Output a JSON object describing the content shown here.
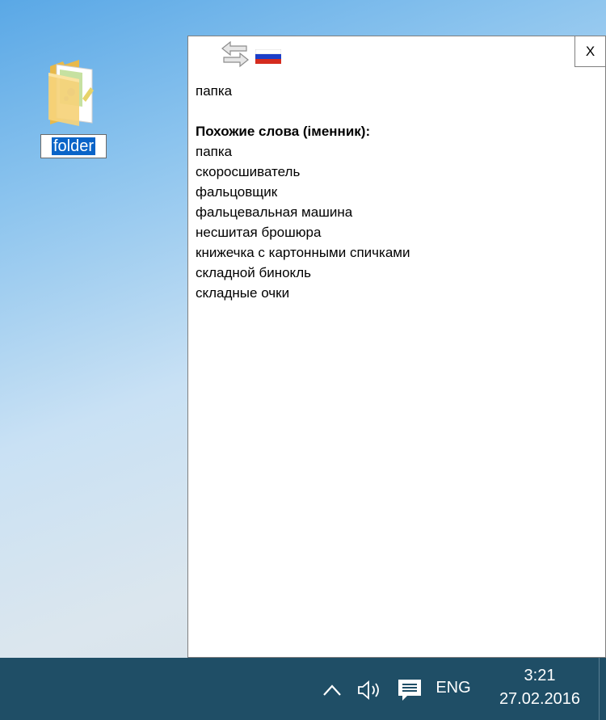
{
  "desktop": {
    "icon_label": "folder",
    "icon": "folder-icon"
  },
  "popup": {
    "close_label": "X",
    "swap_icon": "swap-arrows-icon",
    "flag_icon": "russian-flag-icon",
    "headword": "папка",
    "section_title": "Похожие слова (іменник):",
    "words": [
      "папка",
      "скоросшиватель",
      "фальцовщик",
      "фальцевальная машина",
      "несшитая брошюра",
      "книжечка с картонными спичками",
      "складной бинокль",
      "складные очки"
    ]
  },
  "taskbar": {
    "color": "#1f4e66",
    "language": "ENG",
    "time": "3:21",
    "date": "27.02.2016",
    "icons": [
      "chevron-up-icon",
      "volume-icon",
      "action-center-icon"
    ]
  }
}
